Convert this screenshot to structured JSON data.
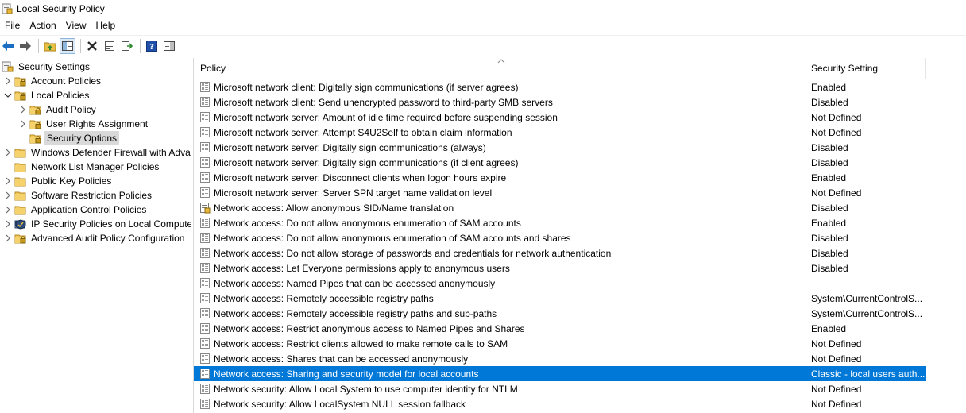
{
  "window": {
    "title": "Local Security Policy"
  },
  "menu": [
    "File",
    "Action",
    "View",
    "Help"
  ],
  "toolbar": {
    "icons": [
      "back-arrow-icon",
      "forward-arrow-icon",
      "up-folder-icon",
      "show-hide-tree-icon",
      "delete-icon",
      "properties-icon",
      "export-list-icon",
      "help-icon",
      "show-hide-action-pane-icon"
    ]
  },
  "tree": {
    "root": "Security Settings",
    "items": [
      {
        "label": "Account Policies",
        "level": 1,
        "expander": "collapsed",
        "icon": "folder-lock-icon"
      },
      {
        "label": "Local Policies",
        "level": 1,
        "expander": "expanded",
        "icon": "folder-lock-icon"
      },
      {
        "label": "Audit Policy",
        "level": 2,
        "expander": "collapsed",
        "icon": "folder-lock-icon"
      },
      {
        "label": "User Rights Assignment",
        "level": 2,
        "expander": "collapsed",
        "icon": "folder-lock-icon"
      },
      {
        "label": "Security Options",
        "level": 2,
        "expander": "none",
        "icon": "folder-lock-icon",
        "selected": true
      },
      {
        "label": "Windows Defender Firewall with Adva",
        "level": 1,
        "expander": "collapsed",
        "icon": "folder-icon"
      },
      {
        "label": "Network List Manager Policies",
        "level": 1,
        "expander": "none",
        "icon": "folder-icon"
      },
      {
        "label": "Public Key Policies",
        "level": 1,
        "expander": "collapsed",
        "icon": "folder-icon"
      },
      {
        "label": "Software Restriction Policies",
        "level": 1,
        "expander": "collapsed",
        "icon": "folder-icon"
      },
      {
        "label": "Application Control Policies",
        "level": 1,
        "expander": "collapsed",
        "icon": "folder-icon"
      },
      {
        "label": "IP Security Policies on Local Compute",
        "level": 1,
        "expander": "collapsed",
        "icon": "ip-security-shield-icon"
      },
      {
        "label": "Advanced Audit Policy Configuration",
        "level": 1,
        "expander": "collapsed",
        "icon": "folder-lock-icon"
      }
    ]
  },
  "list": {
    "columns": {
      "policy": "Policy",
      "setting": "Security Setting"
    },
    "rows": [
      {
        "policy": "Microsoft network client: Digitally sign communications (if server agrees)",
        "setting": "Enabled"
      },
      {
        "policy": "Microsoft network client: Send unencrypted password to third-party SMB servers",
        "setting": "Disabled"
      },
      {
        "policy": "Microsoft network server: Amount of idle time required before suspending session",
        "setting": "Not Defined"
      },
      {
        "policy": "Microsoft network server: Attempt S4U2Self to obtain claim information",
        "setting": "Not Defined"
      },
      {
        "policy": "Microsoft network server: Digitally sign communications (always)",
        "setting": "Disabled"
      },
      {
        "policy": "Microsoft network server: Digitally sign communications (if client agrees)",
        "setting": "Disabled"
      },
      {
        "policy": "Microsoft network server: Disconnect clients when logon hours expire",
        "setting": "Enabled"
      },
      {
        "policy": "Microsoft network server: Server SPN target name validation level",
        "setting": "Not Defined"
      },
      {
        "policy": "Network access: Allow anonymous SID/Name translation",
        "setting": "Disabled",
        "icon": "policy-edit-icon"
      },
      {
        "policy": "Network access: Do not allow anonymous enumeration of SAM accounts",
        "setting": "Enabled"
      },
      {
        "policy": "Network access: Do not allow anonymous enumeration of SAM accounts and shares",
        "setting": "Disabled"
      },
      {
        "policy": "Network access: Do not allow storage of passwords and credentials for network authentication",
        "setting": "Disabled"
      },
      {
        "policy": "Network access: Let Everyone permissions apply to anonymous users",
        "setting": "Disabled"
      },
      {
        "policy": "Network access: Named Pipes that can be accessed anonymously",
        "setting": ""
      },
      {
        "policy": "Network access: Remotely accessible registry paths",
        "setting": "System\\CurrentControlS..."
      },
      {
        "policy": "Network access: Remotely accessible registry paths and sub-paths",
        "setting": "System\\CurrentControlS..."
      },
      {
        "policy": "Network access: Restrict anonymous access to Named Pipes and Shares",
        "setting": "Enabled"
      },
      {
        "policy": "Network access: Restrict clients allowed to make remote calls to SAM",
        "setting": "Not Defined"
      },
      {
        "policy": "Network access: Shares that can be accessed anonymously",
        "setting": "Not Defined"
      },
      {
        "policy": "Network access: Sharing and security model for local accounts",
        "setting": "Classic - local users auth...",
        "selected": true
      },
      {
        "policy": "Network security: Allow Local System to use computer identity for NTLM",
        "setting": "Not Defined"
      },
      {
        "policy": "Network security: Allow LocalSystem NULL session fallback",
        "setting": "Not Defined"
      }
    ]
  },
  "colors": {
    "selection": "#0078d7",
    "tree_selection": "#d9d9d9"
  }
}
